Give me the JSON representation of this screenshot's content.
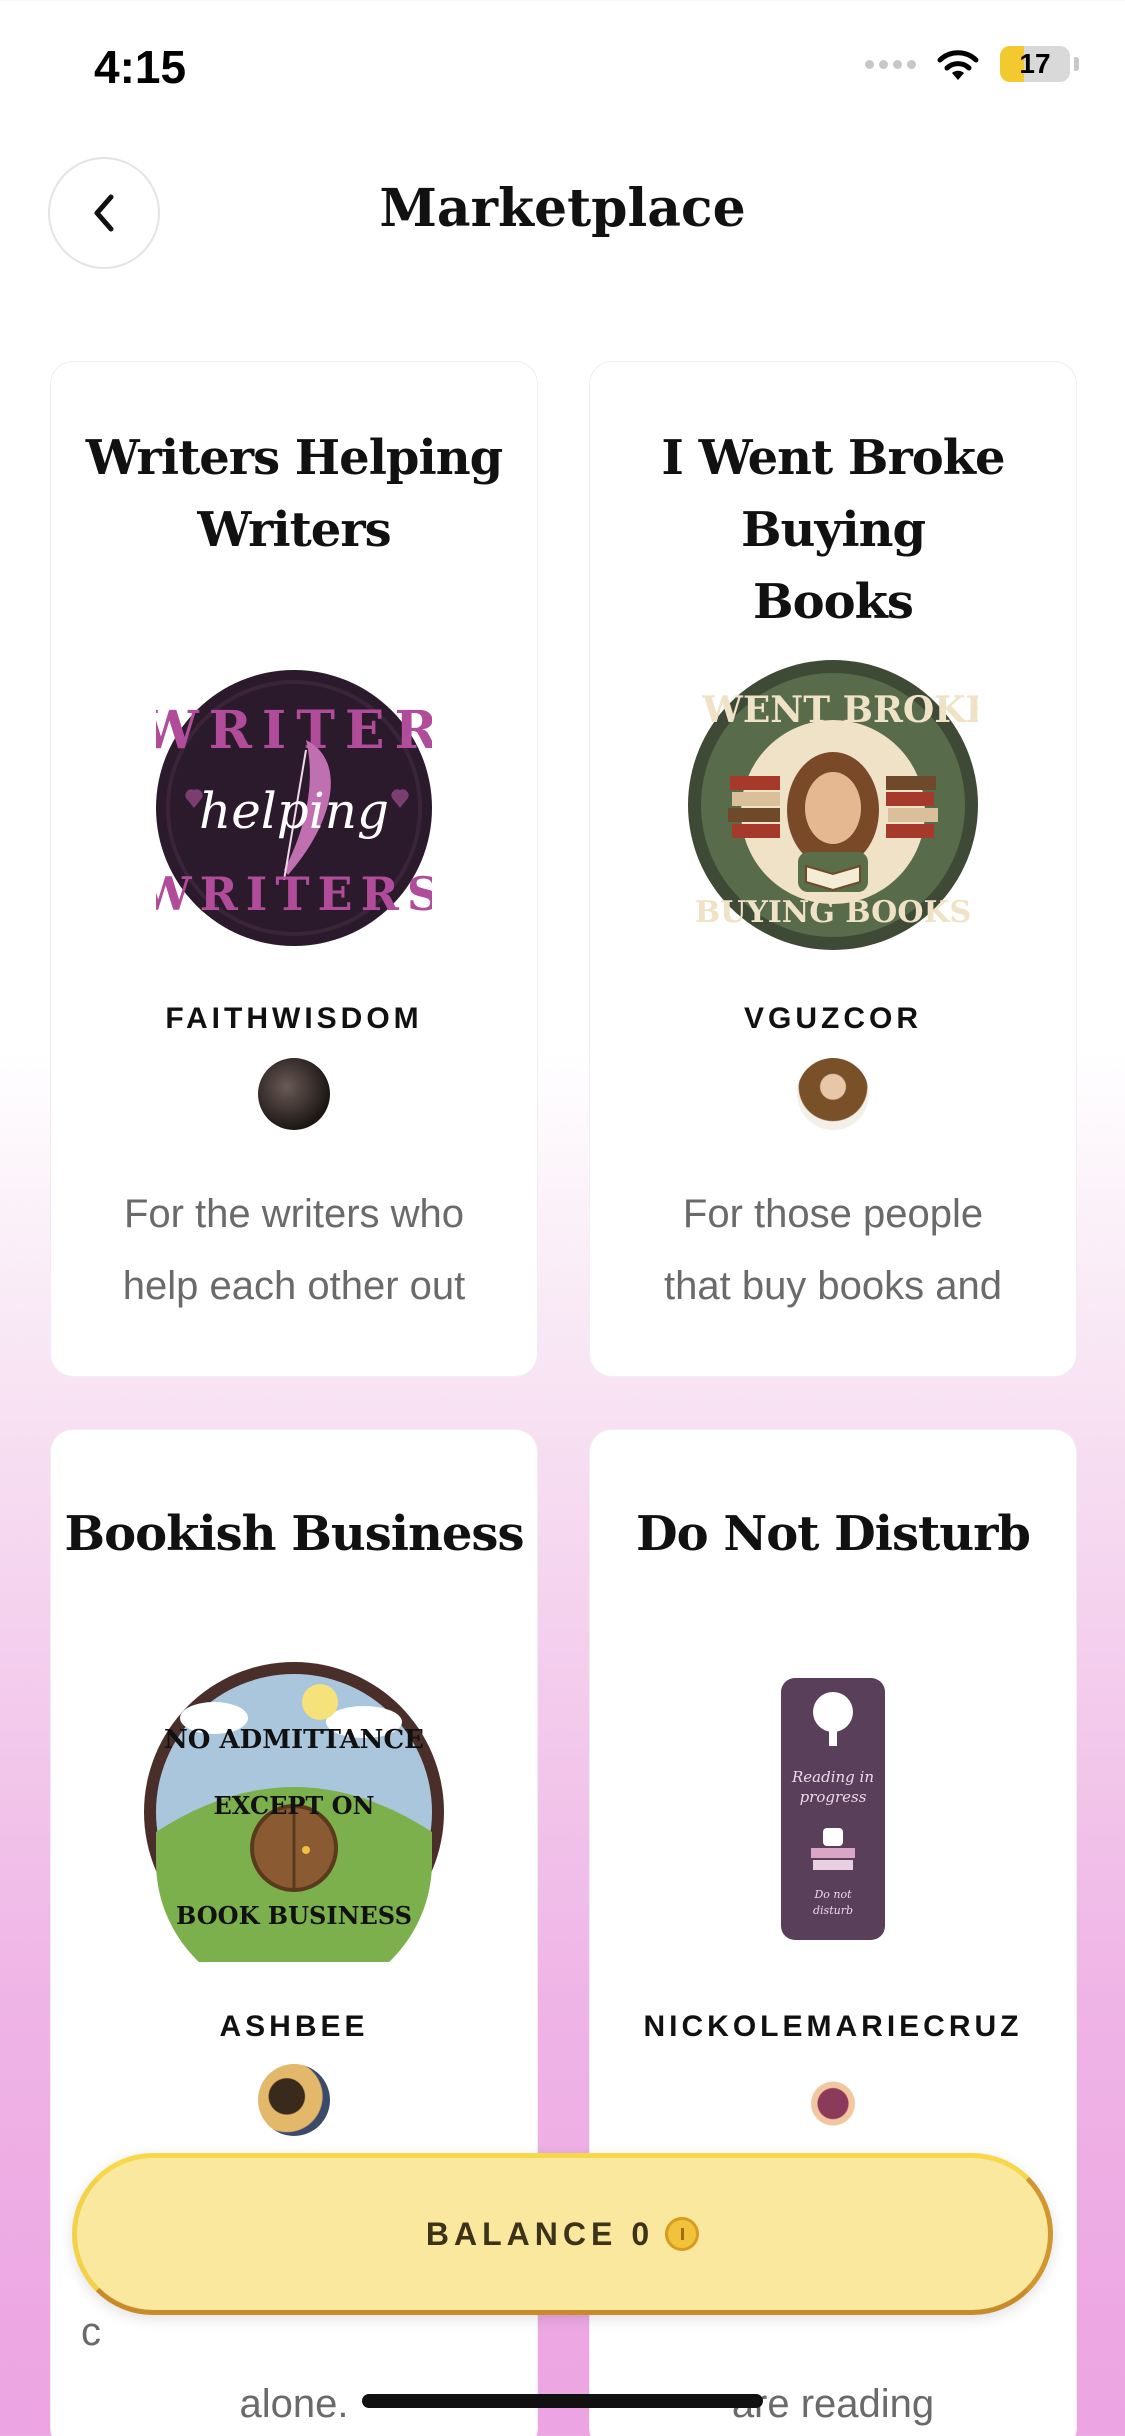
{
  "status_bar": {
    "time": "4:15",
    "battery": "17"
  },
  "header": {
    "title": "Marketplace"
  },
  "cards": [
    {
      "title_line1": "Writers Helping",
      "title_line2": "Writers",
      "owner": "FAITHWISDOM",
      "desc_line1": "For the writers who",
      "desc_line2": "help each other out",
      "image_text": [
        "WRITER",
        "helping",
        "WRITERS"
      ],
      "image_icon": "feather-logo"
    },
    {
      "title_line1": "I Went Broke Buying",
      "title_line2": "Books",
      "owner": "VGUZCOR",
      "desc_line1": "For those people",
      "desc_line2": "that buy books and",
      "image_text": [
        "I WENT BROKE",
        "BUYING BOOKS"
      ],
      "image_icon": "woman-with-books-logo"
    },
    {
      "title_line1": "Bookish Business",
      "owner": "ASHBEE",
      "desc_line1": "c",
      "desc_line2": "alone.",
      "image_text": [
        "NO ADMITTANCE",
        "EXCEPT ON",
        "BOOK BUSINESS"
      ],
      "image_icon": "hobbit-door-logo"
    },
    {
      "title_line1": "Do Not Disturb",
      "owner": "NICKOLEMARIECRUZ",
      "desc_line2": "are reading",
      "image_text": [
        "Reading in",
        "progress",
        "Do not",
        "disturb"
      ],
      "image_icon": "door-hanger-icon"
    }
  ],
  "balance": {
    "label": "BALANCE",
    "value": "0"
  },
  "colors": {
    "balance_bg": "#fae89e",
    "balance_border": "#d2962e",
    "gradient_pink": "#eca4e2"
  }
}
